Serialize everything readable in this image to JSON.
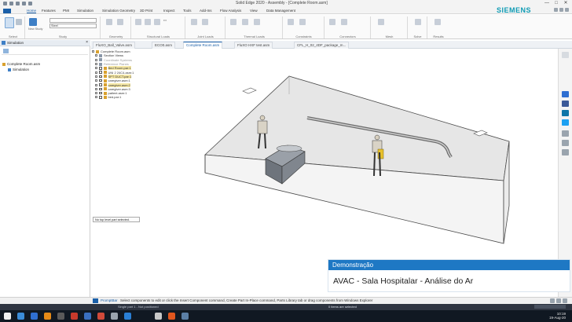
{
  "window": {
    "title": "Solid Edge 2020 - Assembly - [Complete Room.asm]",
    "controls": [
      "—",
      "□",
      "✕"
    ]
  },
  "menu": {
    "items": [
      "Home",
      "Features",
      "PMI",
      "Simulation",
      "Simulation Geometry",
      "3D Print",
      "Inspect",
      "Tools",
      "Add-Ins",
      "Flow Analysis",
      "View",
      "Data Management"
    ],
    "active_index": 0
  },
  "brand": "SIEMENS",
  "ribbon": {
    "groups": [
      {
        "label": "Select",
        "items": []
      },
      {
        "label": "Study",
        "items": [
          "New Study",
          "Steel"
        ]
      },
      {
        "label": "Geometry",
        "items": []
      },
      {
        "label": "Structural Loads",
        "items": [
          "Force",
          "Pressure",
          "Torque"
        ]
      },
      {
        "label": "Joint Loads",
        "items": []
      },
      {
        "label": "Thermal Loads",
        "items": []
      },
      {
        "label": "Constraints",
        "items": []
      },
      {
        "label": "Connectors",
        "items": []
      },
      {
        "label": "Mesh",
        "items": []
      },
      {
        "label": "Solve",
        "items": []
      },
      {
        "label": "Results",
        "items": []
      }
    ]
  },
  "left_panel": {
    "title": "Simulation",
    "tree": [
      {
        "label": "Complete Room.asm",
        "level": 0
      },
      {
        "label": "Simulation",
        "level": 1
      }
    ]
  },
  "tabs": [
    {
      "label": "FluXO_Ball_Valve.asm"
    },
    {
      "label": "ECO0.asm"
    },
    {
      "label": "Complete Room.asm",
      "active": true
    },
    {
      "label": "FluXO HXF test.asm"
    },
    {
      "label": "CFL_H_02_4DF_package_m..."
    }
  ],
  "pathfinder": [
    {
      "label": "Complete Room.asm",
      "level": 0,
      "color": "#d9a12f"
    },
    {
      "label": "Section Views",
      "level": 1,
      "color": "#8a97a8"
    },
    {
      "label": "Coordinate Systems",
      "level": 1,
      "color": "#8a97a8"
    },
    {
      "label": "Reference Planes",
      "level": 1,
      "color": "#8a97a8"
    },
    {
      "label": "Bed Room.par:1",
      "level": 1,
      "color": "#d9a12f"
    },
    {
      "label": "UNI 2 24C4.asm:1",
      "level": 1,
      "color": "#d9a12f"
    },
    {
      "label": "SPT DUCT.par:1",
      "level": 1,
      "color": "#d9a12f"
    },
    {
      "label": "caregiver.asm:1",
      "level": 1,
      "color": "#d9a12f"
    },
    {
      "label": "caregiver.asm:2",
      "level": 1,
      "color": "#d9a12f"
    },
    {
      "label": "caregiver.asm:3",
      "level": 1,
      "color": "#d9a12f"
    },
    {
      "label": "patient.asm:1",
      "level": 1,
      "color": "#d9a12f"
    },
    {
      "label": "bed.par:1",
      "level": 1,
      "color": "#d9a12f"
    }
  ],
  "part_info": "No top level part selected.",
  "overlay": {
    "heading": "Demonstração",
    "title": "AVAC - Sala Hospitalar - Análise do Ar"
  },
  "statusbar": {
    "label": "PromptBar",
    "prompt": "Select components to edit or click the Insert Component command, Create Part In-Place command, Parts Library tab or drag components from Windows Explorer",
    "status_left": "Single part 1 - Not positioned",
    "status_center": "0 items are selected"
  },
  "taskbar": {
    "time": "10:19",
    "date": "19-Aug-20",
    "apps": [
      "#f0f0f0",
      "#3b8cd8",
      "#2f6fd1",
      "#e58a17",
      "#5a5a5a",
      "#c83a2c",
      "#3a6fbf",
      "#d04a3a",
      "#9aa4ae",
      "#2a7fd4"
    ]
  },
  "colors": {
    "accent": "#1e78c4",
    "brand": "#0e9bb4",
    "room_fill": "#f1f1f1",
    "room_top": "#e2e2e2",
    "room_stroke": "#444444"
  },
  "icons": {
    "right_rail": [
      "collapse-icon",
      "globe-icon",
      "facebook-icon",
      "linkedin-icon",
      "twitter-icon",
      "parts-library-icon",
      "layers-icon",
      "view-icon"
    ]
  }
}
